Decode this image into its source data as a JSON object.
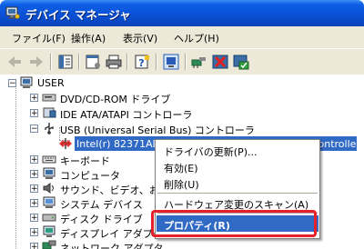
{
  "window": {
    "title": "デバイス マネージャ"
  },
  "menubar": {
    "items": [
      "ファイル(F)",
      "操作(A)",
      "表示(V)",
      "ヘルプ(H)"
    ]
  },
  "tree": {
    "root": "USER",
    "nodes": [
      {
        "label": "DVD/CD-ROM ドライブ",
        "icon": "dvd-drive-icon"
      },
      {
        "label": "IDE ATA/ATAPI コントローラ",
        "icon": "ide-controller-icon"
      },
      {
        "label": "USB (Universal Serial Bus) コントローラ",
        "icon": "usb-icon"
      },
      {
        "label": "Intel(r) 82371AB/EB PCI to USB Universal Host Controller",
        "icon": "usb-warning-icon"
      },
      {
        "label": "キーボード",
        "icon": "keyboard-icon"
      },
      {
        "label": "コンピュータ",
        "icon": "computer-icon"
      },
      {
        "label": "サウンド、ビデオ、およ",
        "icon": "sound-icon"
      },
      {
        "label": "システム デバイス",
        "icon": "system-device-icon"
      },
      {
        "label": "ディスク ドライブ",
        "icon": "disk-drive-icon"
      },
      {
        "label": "ディスプレイ アダプタ",
        "icon": "display-adapter-icon"
      },
      {
        "label": "ネットワーク アダプタ",
        "icon": "network-adapter-icon"
      }
    ]
  },
  "context_menu": {
    "items": [
      "ドライバの更新(P)...",
      "有効(E)",
      "削除(U)",
      "ハードウェア変更のスキャン(A)",
      "プロパティ(R)"
    ]
  },
  "colors": {
    "titlebar": "#0a4fd3",
    "selection": "#316ac5",
    "highlight_box": "#e8202a",
    "chrome": "#ece9d8"
  }
}
